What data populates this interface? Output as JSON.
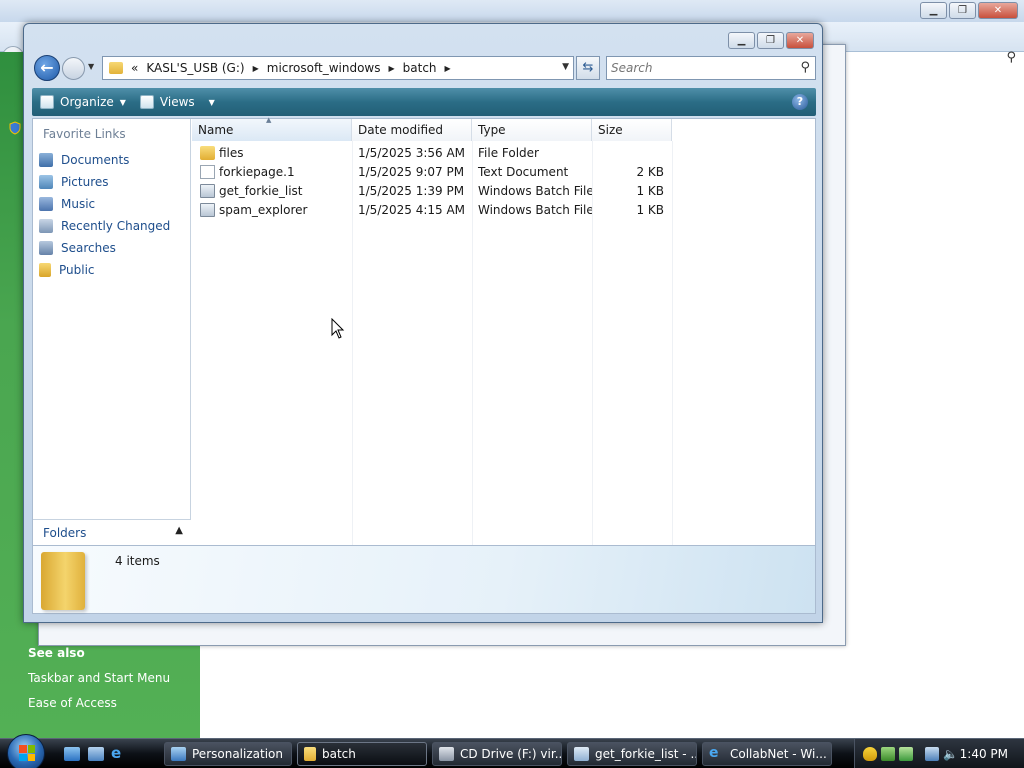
{
  "explorer": {
    "address": {
      "chevron": "«",
      "segments": [
        "KASL'S_USB (G:)",
        "microsoft_windows",
        "batch"
      ]
    },
    "search_placeholder": "Search",
    "toolbar": {
      "organize_label": "Organize",
      "views_label": "Views",
      "help_label": "?"
    },
    "nav_pane": {
      "title": "Favorite Links",
      "links": [
        "Documents",
        "Pictures",
        "Music",
        "Recently Changed",
        "Searches",
        "Public"
      ],
      "folders_label": "Folders"
    },
    "columns": [
      "Name",
      "Date modified",
      "Type",
      "Size"
    ],
    "files": [
      {
        "name": "files",
        "date": "1/5/2025 3:56 AM",
        "type": "File Folder",
        "size": "",
        "icon": "folder-icon"
      },
      {
        "name": "forkiepage.1",
        "date": "1/5/2025 9:07 PM",
        "type": "Text Document",
        "size": "2 KB",
        "icon": "text-file-icon"
      },
      {
        "name": "get_forkie_list",
        "date": "1/5/2025 1:39 PM",
        "type": "Windows Batch File",
        "size": "1 KB",
        "icon": "batch-file-icon"
      },
      {
        "name": "spam_explorer",
        "date": "1/5/2025 4:15 AM",
        "type": "Windows Batch File",
        "size": "1 KB",
        "icon": "batch-file-icon"
      }
    ],
    "details": {
      "items_count": "4 items"
    }
  },
  "background": {
    "see_also_title": "See also",
    "see_also_links": [
      "Taskbar and Start Menu",
      "Ease of Access"
    ]
  },
  "taskbar": {
    "buttons": [
      {
        "label": "Personalization",
        "icon": "personalization-icon"
      },
      {
        "label": "batch",
        "icon": "folder-icon"
      },
      {
        "label": "CD Drive (F:) vir...",
        "icon": "cd-drive-icon"
      },
      {
        "label": "get_forkie_list - ...",
        "icon": "notepad-icon"
      },
      {
        "label": "CollabNet - Wi...",
        "icon": "ie-icon"
      }
    ],
    "clock": "1:40 PM"
  },
  "colors": {
    "toolbar": "#2b6d86",
    "link": "#1e4e8c",
    "left_pane_green": "#4aa650"
  }
}
